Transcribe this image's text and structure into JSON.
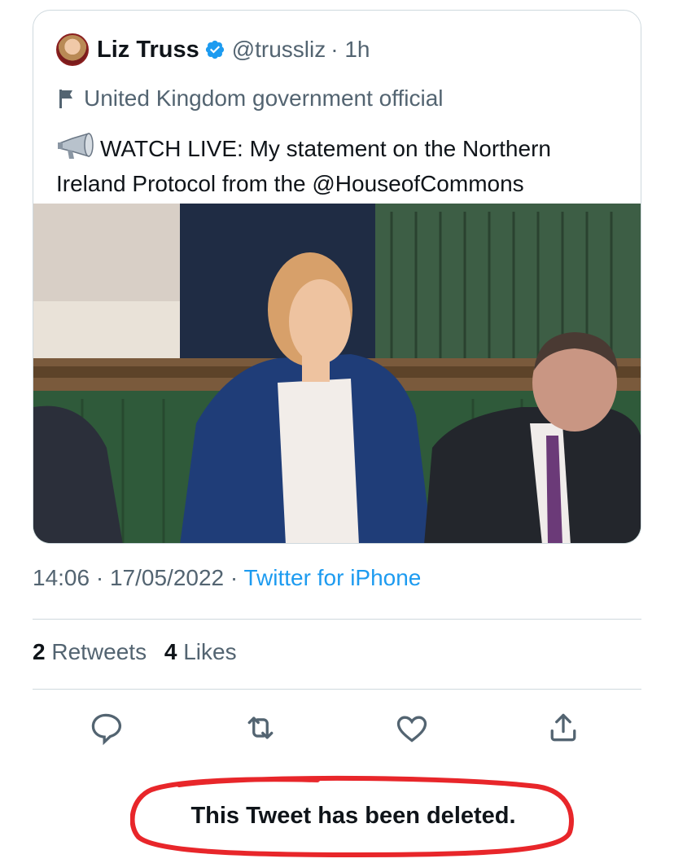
{
  "tweet": {
    "author_name": "Liz Truss",
    "handle": "@trussliz",
    "time_ago": "· 1h",
    "label": "United Kingdom government official",
    "text": "WATCH LIVE: My statement on the Northern Ireland Protocol from the @HouseofCommons"
  },
  "meta": {
    "time": "14:06",
    "date": "17/05/2022",
    "separator": "·",
    "source": "Twitter for iPhone"
  },
  "stats": {
    "retweets_count": "2",
    "retweets_label": "Retweets",
    "likes_count": "4",
    "likes_label": "Likes"
  },
  "actions": [
    "reply-icon",
    "retweet-icon",
    "like-icon",
    "share-icon"
  ],
  "notice": {
    "text": "This Tweet has been deleted."
  },
  "colors": {
    "text": "#0f1419",
    "secondary": "#536471",
    "link": "#1d9bf0",
    "border": "#cfd9de",
    "verified": "#1d9bf0",
    "annotation": "#e8262a"
  }
}
